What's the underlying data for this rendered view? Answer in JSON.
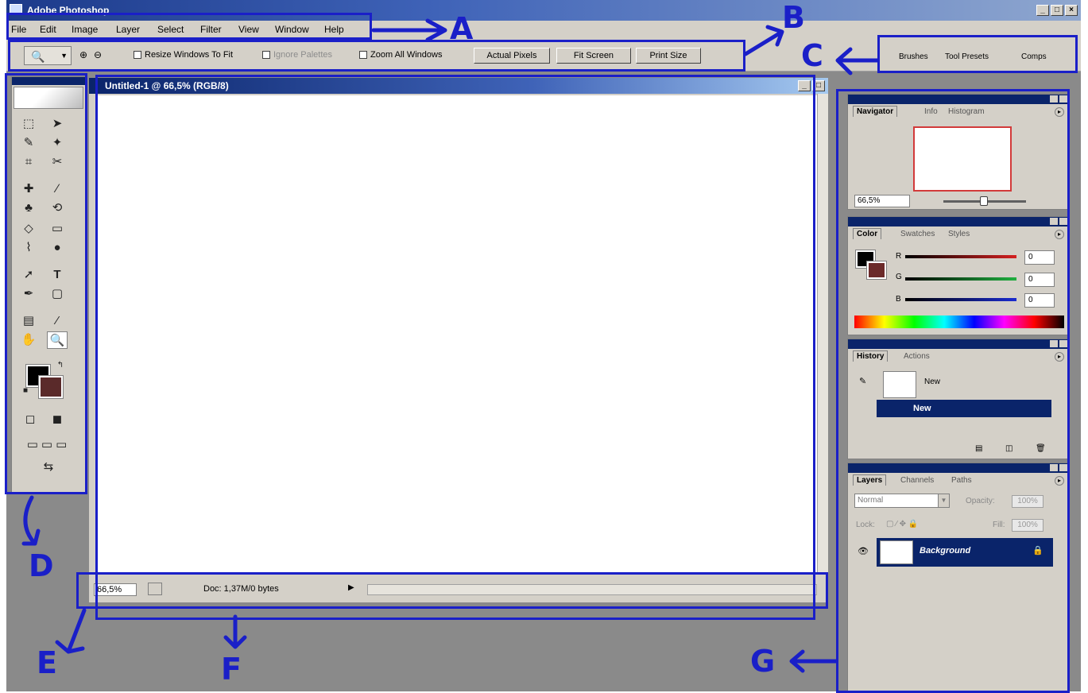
{
  "app": {
    "title": "Adobe Photoshop"
  },
  "window_controls": {
    "minimize": "_",
    "maximize": "□",
    "close": "×"
  },
  "menu": [
    "File",
    "Edit",
    "Image",
    "Layer",
    "Select",
    "Filter",
    "View",
    "Window",
    "Help"
  ],
  "options_bar": {
    "tool_icon": "zoom-tool-icon",
    "resize_windows": "Resize Windows To Fit",
    "ignore_palettes": "Ignore Palettes",
    "zoom_all": "Zoom All Windows",
    "actual_pixels": "Actual Pixels",
    "fit_screen": "Fit Screen",
    "print_size": "Print Size"
  },
  "palette_well": {
    "tabs": [
      "Brushes",
      "Tool Presets",
      "Comps"
    ]
  },
  "document": {
    "title": "Untitled-1 @ 66,5% (RGB/8)",
    "zoom": "66,5%",
    "doc_size": "Doc: 1,37M/0 bytes"
  },
  "navigator": {
    "tabs": [
      "Navigator",
      "Info",
      "Histogram"
    ],
    "zoom": "66,5%"
  },
  "color": {
    "tabs": [
      "Color",
      "Swatches",
      "Styles"
    ],
    "channels": [
      {
        "label": "R",
        "value": "0",
        "color": "#d42020"
      },
      {
        "label": "G",
        "value": "0",
        "color": "#20b040"
      },
      {
        "label": "B",
        "value": "0",
        "color": "#1a2bd0"
      }
    ],
    "foreground": "#000000",
    "background": "#6b2a2a"
  },
  "history": {
    "tabs": [
      "History",
      "Actions"
    ],
    "snapshot": "New",
    "state": "New"
  },
  "layers": {
    "tabs": [
      "Layers",
      "Channels",
      "Paths"
    ],
    "blend_mode": "Normal",
    "opacity_label": "Opacity:",
    "opacity": "100%",
    "lock_label": "Lock:",
    "fill_label": "Fill:",
    "fill": "100%",
    "layer_name": "Background"
  },
  "annotations": [
    "A",
    "B",
    "C",
    "D",
    "E",
    "F",
    "G"
  ],
  "colors": {
    "annotation": "#1a1fc8",
    "title_blue": "#0a246a",
    "chrome": "#d4d0c8"
  }
}
